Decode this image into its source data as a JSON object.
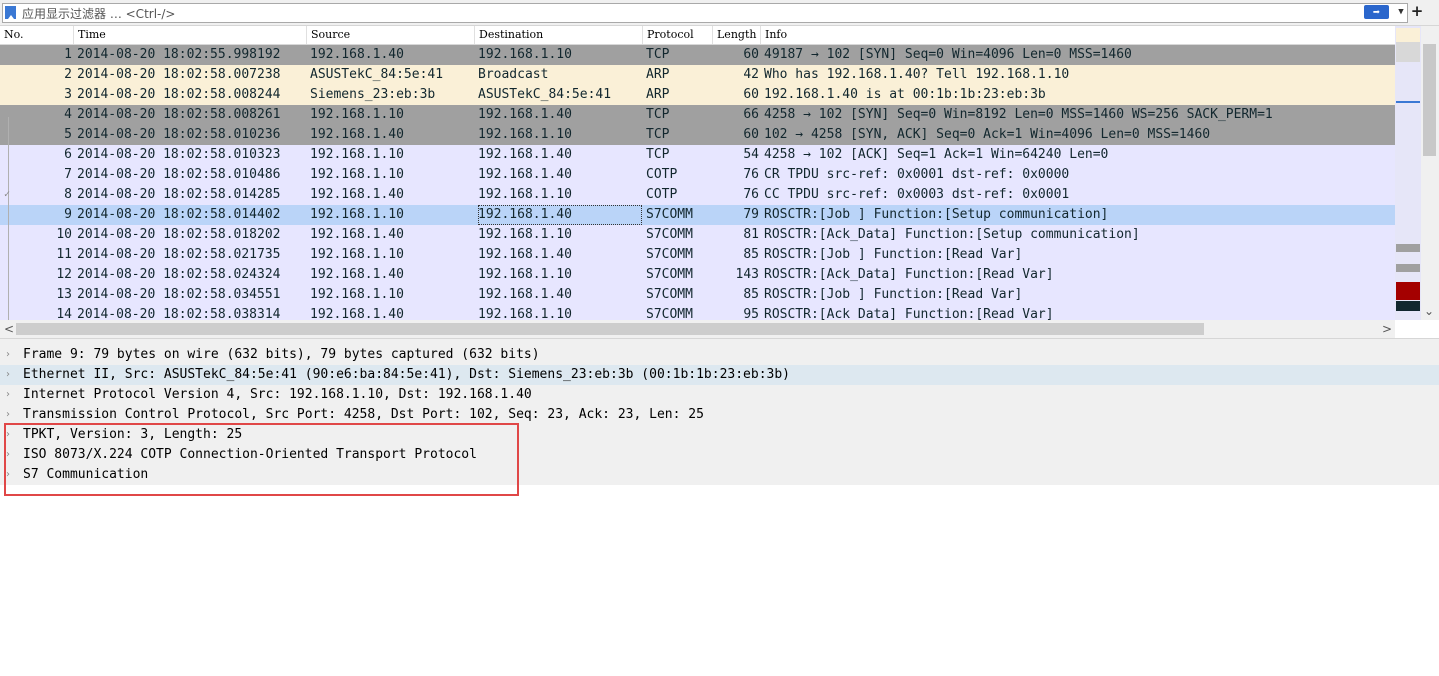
{
  "filter": {
    "placeholder": "应用显示过滤器 … <Ctrl-/>",
    "apply_icon": "arrow-right-icon",
    "add_label": "+"
  },
  "columns": [
    "No.",
    "Time",
    "Source",
    "Destination",
    "Protocol",
    "Length",
    "Info"
  ],
  "packets": [
    {
      "no": "1",
      "time": "2014-08-20 18:02:55.998192",
      "src": "192.168.1.40",
      "dst": "192.168.1.10",
      "proto": "TCP",
      "len": "60",
      "info": "49187 → 102 [SYN] Seq=0 Win=4096 Len=0 MSS=1460",
      "bg": "#a0a0a0",
      "fg": "#12272e"
    },
    {
      "no": "2",
      "time": "2014-08-20 18:02:58.007238",
      "src": "ASUSTekC_84:5e:41",
      "dst": "Broadcast",
      "proto": "ARP",
      "len": "42",
      "info": "Who has 192.168.1.40? Tell 192.168.1.10",
      "bg": "#faf0d7",
      "fg": "#12272e"
    },
    {
      "no": "3",
      "time": "2014-08-20 18:02:58.008244",
      "src": "Siemens_23:eb:3b",
      "dst": "ASUSTekC_84:5e:41",
      "proto": "ARP",
      "len": "60",
      "info": "192.168.1.40 is at 00:1b:1b:23:eb:3b",
      "bg": "#faf0d7",
      "fg": "#12272e"
    },
    {
      "no": "4",
      "time": "2014-08-20 18:02:58.008261",
      "src": "192.168.1.10",
      "dst": "192.168.1.40",
      "proto": "TCP",
      "len": "66",
      "info": "4258 → 102 [SYN] Seq=0 Win=8192 Len=0 MSS=1460 WS=256 SACK_PERM=1",
      "bg": "#a0a0a0",
      "fg": "#12272e"
    },
    {
      "no": "5",
      "time": "2014-08-20 18:02:58.010236",
      "src": "192.168.1.40",
      "dst": "192.168.1.10",
      "proto": "TCP",
      "len": "60",
      "info": "102 → 4258 [SYN, ACK] Seq=0 Ack=1 Win=4096 Len=0 MSS=1460",
      "bg": "#a0a0a0",
      "fg": "#12272e"
    },
    {
      "no": "6",
      "time": "2014-08-20 18:02:58.010323",
      "src": "192.168.1.10",
      "dst": "192.168.1.40",
      "proto": "TCP",
      "len": "54",
      "info": "4258 → 102 [ACK] Seq=1 Ack=1 Win=64240 Len=0",
      "bg": "#e7e6ff",
      "fg": "#12272e"
    },
    {
      "no": "7",
      "time": "2014-08-20 18:02:58.010486",
      "src": "192.168.1.10",
      "dst": "192.168.1.40",
      "proto": "COTP",
      "len": "76",
      "info": "CR TPDU src-ref: 0x0001 dst-ref: 0x0000",
      "bg": "#e7e6ff",
      "fg": "#12272e"
    },
    {
      "no": "8",
      "time": "2014-08-20 18:02:58.014285",
      "src": "192.168.1.40",
      "dst": "192.168.1.10",
      "proto": "COTP",
      "len": "76",
      "info": "CC TPDU src-ref: 0x0003 dst-ref: 0x0001",
      "bg": "#e7e6ff",
      "fg": "#12272e"
    },
    {
      "no": "9",
      "time": "2014-08-20 18:02:58.014402",
      "src": "192.168.1.10",
      "dst": "192.168.1.40",
      "proto": "S7COMM",
      "len": "79",
      "info": "ROSCTR:[Job     ] Function:[Setup communication]",
      "bg": "#bad4f8",
      "fg": "#12272e",
      "selected": true
    },
    {
      "no": "10",
      "time": "2014-08-20 18:02:58.018202",
      "src": "192.168.1.40",
      "dst": "192.168.1.10",
      "proto": "S7COMM",
      "len": "81",
      "info": "ROSCTR:[Ack_Data] Function:[Setup communication]",
      "bg": "#e7e6ff",
      "fg": "#12272e"
    },
    {
      "no": "11",
      "time": "2014-08-20 18:02:58.021735",
      "src": "192.168.1.10",
      "dst": "192.168.1.40",
      "proto": "S7COMM",
      "len": "85",
      "info": "ROSCTR:[Job     ] Function:[Read Var]",
      "bg": "#e7e6ff",
      "fg": "#12272e"
    },
    {
      "no": "12",
      "time": "2014-08-20 18:02:58.024324",
      "src": "192.168.1.40",
      "dst": "192.168.1.10",
      "proto": "S7COMM",
      "len": "143",
      "info": "ROSCTR:[Ack_Data] Function:[Read Var]",
      "bg": "#e7e6ff",
      "fg": "#12272e"
    },
    {
      "no": "13",
      "time": "2014-08-20 18:02:58.034551",
      "src": "192.168.1.10",
      "dst": "192.168.1.40",
      "proto": "S7COMM",
      "len": "85",
      "info": "ROSCTR:[Job     ] Function:[Read Var]",
      "bg": "#e7e6ff",
      "fg": "#12272e"
    },
    {
      "no": "14",
      "time": "2014-08-20 18:02:58.038314",
      "src": "192.168.1.40",
      "dst": "192.168.1.10",
      "proto": "S7COMM",
      "len": "95",
      "info": "ROSCTR:[Ack_Data] Function:[Read Var]",
      "bg": "#e7e6ff",
      "fg": "#12272e"
    }
  ],
  "details": [
    {
      "text": "Frame 9: 79 bytes on wire (632 bits), 79 bytes captured (632 bits)",
      "bg": "#f0f0f0"
    },
    {
      "text": "Ethernet II, Src: ASUSTekC_84:5e:41 (90:e6:ba:84:5e:41), Dst: Siemens_23:eb:3b (00:1b:1b:23:eb:3b)",
      "bg": "#dde8f0"
    },
    {
      "text": "Internet Protocol Version 4, Src: 192.168.1.10, Dst: 192.168.1.40",
      "bg": "#f0f0f0"
    },
    {
      "text": "Transmission Control Protocol, Src Port: 4258, Dst Port: 102, Seq: 23, Ack: 23, Len: 25",
      "bg": "#f0f0f0"
    },
    {
      "text": "TPKT, Version: 3, Length: 25",
      "bg": "#f0f0f0"
    },
    {
      "text": "ISO 8073/X.224 COTP Connection-Oriented Transport Protocol",
      "bg": "#f0f0f0"
    },
    {
      "text": "S7 Communication",
      "bg": "#f0f0f0"
    }
  ],
  "colors": {
    "highlight_box": "#e04747",
    "selected_row": "#bad4f8",
    "tcp_syn_row": "#a0a0a0",
    "arp_row": "#faf0d7",
    "default_row": "#e7e6ff"
  }
}
